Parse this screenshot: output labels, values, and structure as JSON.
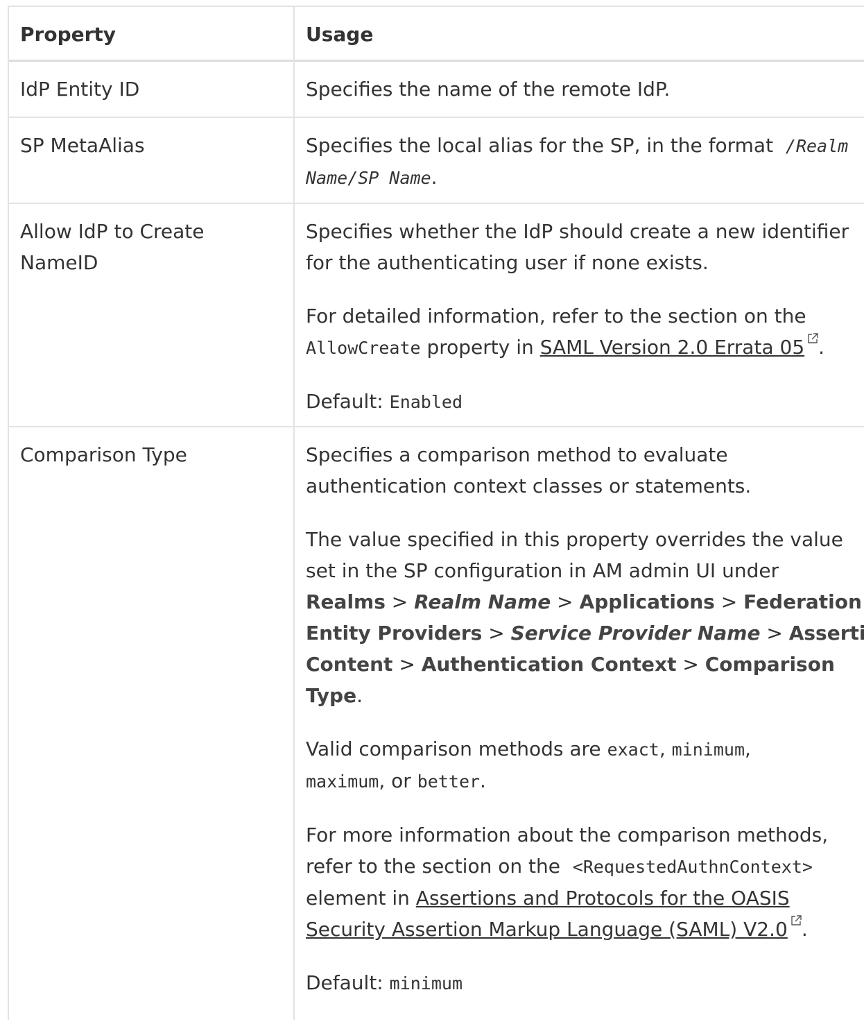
{
  "table": {
    "headers": {
      "property": "Property",
      "usage": "Usage"
    },
    "rows": {
      "idp_entity_id": {
        "property": "IdP Entity ID",
        "usage": "Specifies the name of the remote IdP."
      },
      "sp_metaalias": {
        "property": "SP MetaAlias",
        "usage_prefix": "Specifies the local alias for the SP, in the format",
        "code_1": "/Realm",
        "code_2": "Name/SP Name",
        "period": "."
      },
      "allow_create": {
        "property_line1": "Allow IdP to Create",
        "property_line2": "NameID",
        "p1_line1": "Specifies whether the IdP should create a new identifier",
        "p1_line2": "for the authenticating user if none exists.",
        "p2_line1": "For detailed information, refer to the section on the",
        "p2_code": "AllowCreate",
        "p2_mid": "property in",
        "p2_link": "SAML Version 2.0 Errata 05",
        "period": ".",
        "default_label": "Default:",
        "default_value": "Enabled"
      },
      "comparison_type": {
        "property": "Comparison Type",
        "p1_line1": "Specifies a comparison method to evaluate",
        "p1_line2": "authentication context classes or statements.",
        "p2_line1": "The value specified in this property overrides the value",
        "p2_line2": "set in the SP configuration in AM admin UI under",
        "nav": {
          "realms": "Realms",
          "realm_name": "Realm Name",
          "applications": "Applications",
          "federation": "Federation",
          "entity_providers": "Entity Providers",
          "service_provider_name": "Service Provider Name",
          "assertion": "Assertion",
          "content": "Content",
          "authentication_context": "Authentication Context",
          "comparison": "Comparison",
          "type": "Type",
          "sep": ">"
        },
        "p3_prefix": "Valid comparison methods are",
        "method_exact": "exact",
        "method_minimum": "minimum",
        "method_maximum": "maximum",
        "method_better": "better",
        "comma": ",",
        "or": "or",
        "p4_line1": "For more information about the comparison methods,",
        "p4_line2_prefix": "refer to the section on the",
        "p4_code": "<RequestedAuthnContext>",
        "p4_line3_prefix": "element in",
        "p4_link_line1": "Assertions and Protocols for the OASIS",
        "p4_link_line2": "Security Assertion Markup Language (SAML) V2.0",
        "period": ".",
        "default_label": "Default:",
        "default_value": "minimum"
      }
    }
  },
  "icons": {
    "external_link": "external-link-icon"
  },
  "colors": {
    "border": "#e3e3e3",
    "text": "#333333",
    "bold_text": "#444444"
  }
}
